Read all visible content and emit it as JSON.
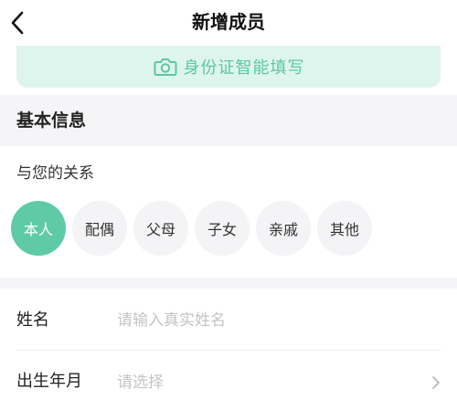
{
  "nav": {
    "title": "新增成员",
    "back_icon": "chevron-left-icon"
  },
  "id_fill": {
    "label": "身份证智能填写",
    "icon": "camera-icon",
    "accent": "#5cc7a4",
    "background": "#def5ee"
  },
  "basic_info": {
    "section_title": "基本信息",
    "relation_label": "与您的关系",
    "relations": [
      {
        "label": "本人",
        "selected": true
      },
      {
        "label": "配偶",
        "selected": false
      },
      {
        "label": "父母",
        "selected": false
      },
      {
        "label": "子女",
        "selected": false
      },
      {
        "label": "亲戚",
        "selected": false
      },
      {
        "label": "其他",
        "selected": false
      }
    ],
    "selected_color": "#5ecba6"
  },
  "form": {
    "name": {
      "label": "姓名",
      "placeholder": "请输入真实姓名",
      "value": ""
    },
    "birth": {
      "label": "出生年月",
      "placeholder": "请选择",
      "icon": "chevron-right-icon"
    }
  }
}
